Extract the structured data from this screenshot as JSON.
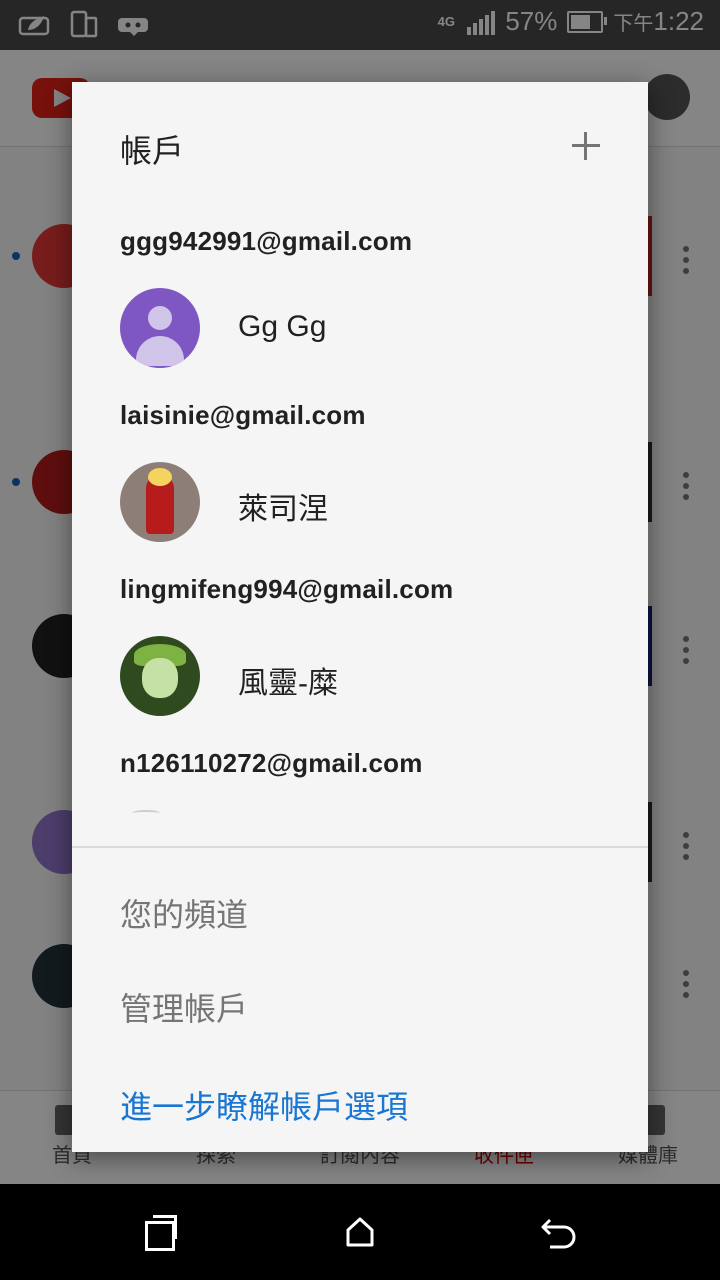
{
  "status_bar": {
    "network": "4G",
    "battery": "57%",
    "battery_level": 0.57,
    "time_period": "下午",
    "time": "1:22"
  },
  "background_app": {
    "nav": [
      {
        "label": "首頁",
        "icon": "home-icon"
      },
      {
        "label": "探索",
        "icon": "explore-icon"
      },
      {
        "label": "訂閱內容",
        "icon": "subscriptions-icon"
      },
      {
        "label": "收件匣",
        "icon": "inbox-icon"
      },
      {
        "label": "媒體庫",
        "icon": "library-icon"
      }
    ]
  },
  "dialog": {
    "title": "帳戶",
    "add_icon": "plus-icon",
    "accounts": [
      {
        "email": "ggg942991@gmail.com",
        "name": "Gg Gg",
        "avatar": "default-avatar"
      },
      {
        "email": "laisinie@gmail.com",
        "name": "萊司涅",
        "avatar": "red-character-avatar"
      },
      {
        "email": "lingmifeng994@gmail.com",
        "name": "風靈-糜",
        "avatar": "green-character-avatar"
      },
      {
        "email": "n126110272@gmail.com",
        "name": "",
        "avatar": "partial-avatar"
      }
    ],
    "menu": {
      "your_channel": "您的頻道",
      "manage_account": "管理帳戶",
      "learn_more": "進一步瞭解帳戶選項"
    }
  },
  "colors": {
    "link": "#1976d2",
    "active_tab": "#cc0000",
    "dialog_bg": "#f5f5f5"
  }
}
